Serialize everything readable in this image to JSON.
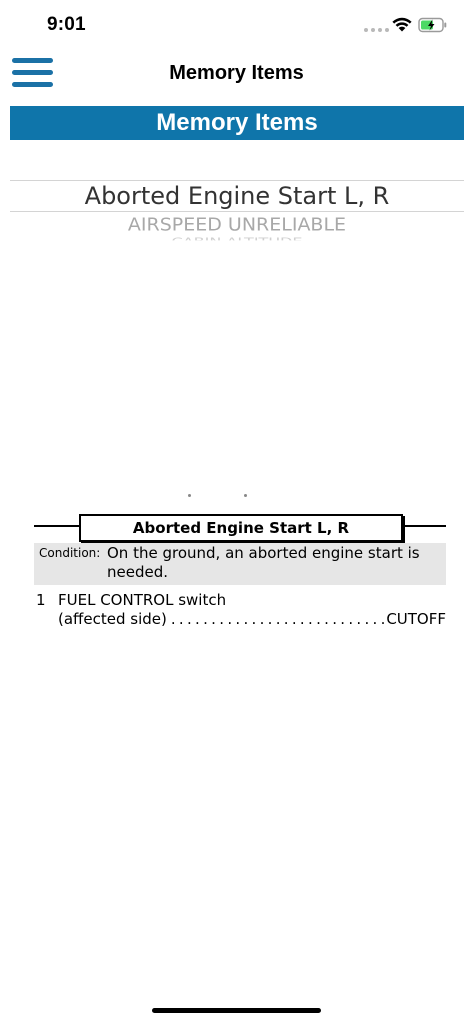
{
  "status_bar": {
    "time": "9:01"
  },
  "nav": {
    "title": "Memory Items",
    "menu_icon": "hamburger-menu-icon"
  },
  "banner": {
    "title": "Memory Items"
  },
  "picker": {
    "selected": "Aborted Engine Start L, R",
    "next": "AIRSPEED UNRELIABLE",
    "next2": "CABIN ALTITUDE"
  },
  "checklist": {
    "title": "Aborted Engine Start L, R",
    "condition_label": "Condition:",
    "condition_text": "On the ground, an aborted engine start is needed.",
    "steps": [
      {
        "number": "1",
        "line1": "FUEL CONTROL switch",
        "line2": "(affected side)",
        "dots": "......................................",
        "action": "CUTOFF"
      }
    ]
  },
  "colors": {
    "accent": "#0f75aa",
    "menu_icon": "#1b71a6",
    "condition_bg": "#e6e6e6",
    "battery_fill": "#4cd964"
  }
}
